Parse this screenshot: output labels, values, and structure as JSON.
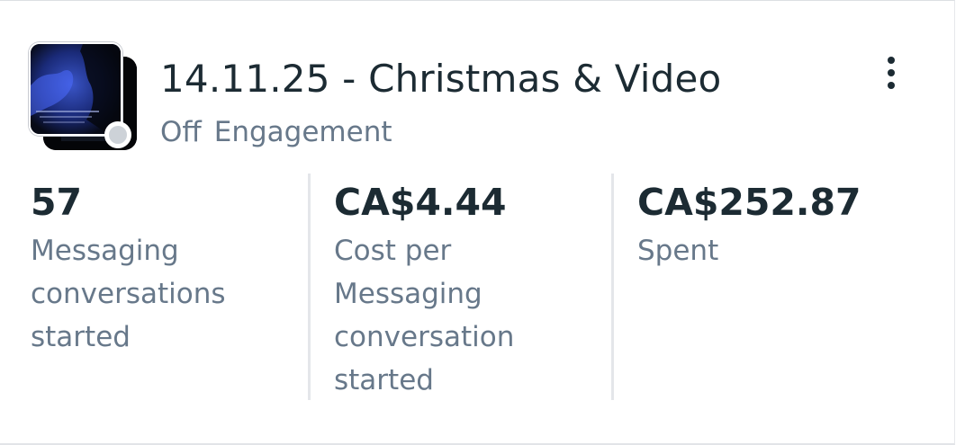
{
  "campaign": {
    "title": "14.11.25 - Christmas & Video",
    "status": "Off",
    "objective": "Engagement"
  },
  "metrics": [
    {
      "value": "57",
      "label": "Messaging conversations started"
    },
    {
      "value": "CA$4.44",
      "label": "Cost per Messaging conversation started"
    },
    {
      "value": "CA$252.87",
      "label": "Spent"
    }
  ],
  "colors": {
    "text_primary": "#1c2b33",
    "text_secondary": "#67788a",
    "status_off": "#cdd2d8",
    "divider": "#e4e6ea"
  },
  "icons": {
    "menu": "more-vertical-icon",
    "status": "status-dot-icon"
  }
}
